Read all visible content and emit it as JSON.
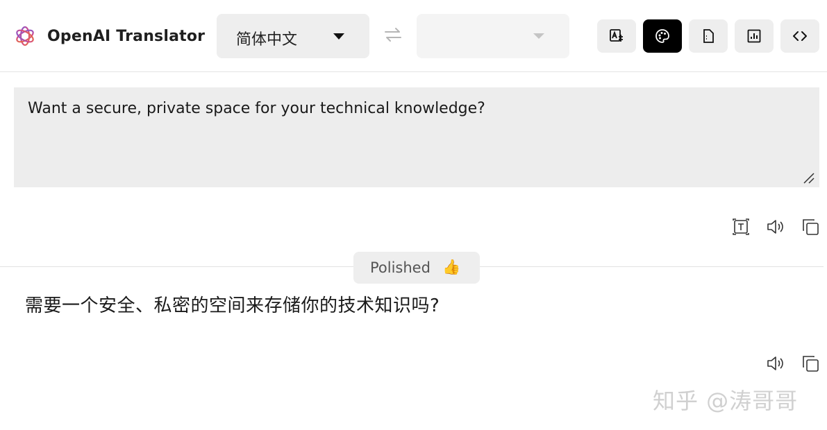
{
  "header": {
    "app_title": "OpenAI Translator",
    "logo_icon": "openai-logo-icon",
    "source_language": "简体中文",
    "target_language": "",
    "swap_icon": "swap-arrows-icon",
    "tools": [
      {
        "name": "translate-settings-icon",
        "active": false
      },
      {
        "name": "palette-icon",
        "active": true
      },
      {
        "name": "file-icon",
        "active": false
      },
      {
        "name": "chart-icon",
        "active": false
      },
      {
        "name": "code-icon",
        "active": false
      }
    ]
  },
  "input": {
    "text": "Want a secure, private space for your technical knowledge?",
    "actions": [
      "ocr-text-icon",
      "speaker-icon",
      "copy-icon"
    ]
  },
  "result": {
    "mode_badge": "Polished",
    "mode_emoji": "👍",
    "text": "需要一个安全、私密的空间来存储你的技术知识吗?",
    "actions": [
      "speaker-icon",
      "copy-icon"
    ]
  },
  "watermark": "知乎 @涛哥哥",
  "colors": {
    "active_button": "#000000",
    "button_bg": "#eeeeee",
    "input_bg": "#ededed"
  }
}
